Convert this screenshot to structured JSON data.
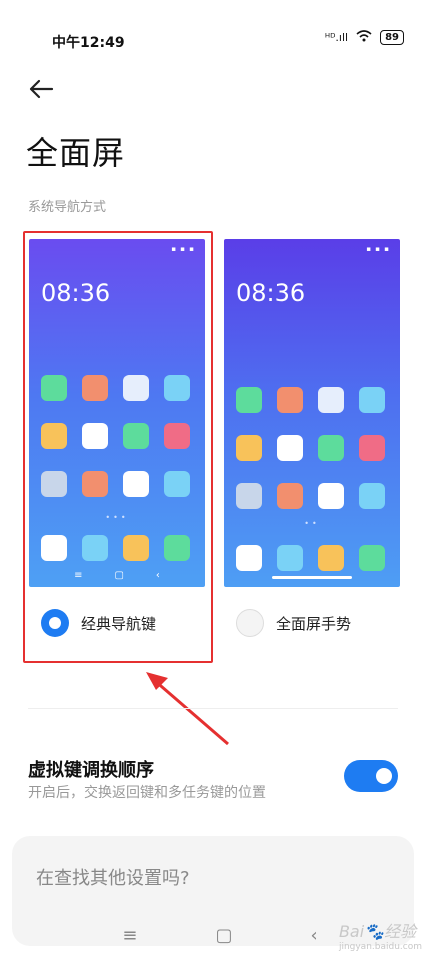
{
  "status": {
    "time": "中午12:49",
    "signal": "ᴴᴰ.ıll",
    "battery": "89"
  },
  "header": {
    "title": "全面屏",
    "section": "系统导航方式"
  },
  "options": [
    {
      "clock": "08:36",
      "label": "经典导航键",
      "selected": true,
      "nav_keys": [
        "≡",
        "▢",
        "‹"
      ]
    },
    {
      "clock": "08:36",
      "label": "全面屏手势",
      "selected": false
    }
  ],
  "toggle": {
    "title": "虚拟键调换顺序",
    "desc": "开启后，交换返回键和多任务键的位置",
    "on": true
  },
  "search": {
    "prompt": "在查找其他设置吗?"
  },
  "bottom_nav": {
    "menu": "≡",
    "home": "▢",
    "back": "‹"
  },
  "watermark": {
    "brand": "Bai",
    "paw": "🐾",
    "sub": "jingyan.baidu.com",
    "suffix": "经验"
  },
  "colors": {
    "accent": "#1e7cf2",
    "highlight": "#e53030",
    "apps_row1": [
      "#5ddc9c",
      "#f28f6e",
      "#e6eefc",
      "#7ad2f6"
    ],
    "apps_row2": [
      "#f8c25a",
      "#ffffff",
      "#5ddc9c",
      "#f06c86"
    ],
    "apps_row3": [
      "#c8d6ea",
      "#f28f6e",
      "#ffffff",
      "#7ad2f6"
    ],
    "dock": [
      "#ffffff",
      "#7ad2f6",
      "#f8c25a",
      "#5ddc9c"
    ]
  }
}
